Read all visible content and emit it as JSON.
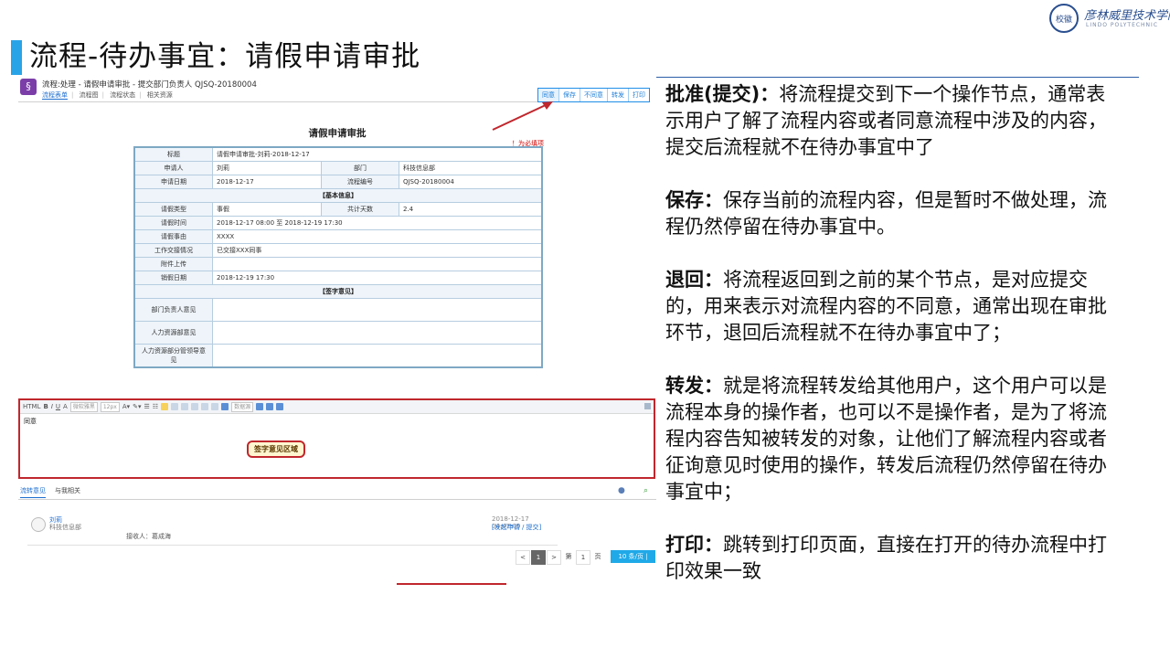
{
  "slide": {
    "title": "流程-待办事宜：请假申请审批",
    "logo_name": "彦林威里技术学院",
    "logo_en": "LINDO POLYTECHNIC",
    "logo_seal": "校徽"
  },
  "app": {
    "title": "流程:处理 - 请假申请审批 - 提交部门负责人 QJSQ-20180004",
    "nav": [
      "流程表单",
      "流程图",
      "流程状态",
      "相关资源"
    ],
    "actions": [
      "同意",
      "保存",
      "不同意",
      "转发",
      "打印"
    ],
    "form_title": "请假申请审批",
    "required_note": "！为必填项",
    "form": {
      "title_label": "标题",
      "title_value": "请假申请审批-刘莉-2018-12-17",
      "applicant_label": "申请人",
      "applicant_value": "刘莉",
      "dept_label": "部门",
      "dept_value": "科技信息部",
      "date_label": "申请日期",
      "date_value": "2018-12-17",
      "flowno_label": "流程编号",
      "flowno_value": "QJSQ-20180004",
      "section_basic": "【基本信息】",
      "leave_type_label": "请假类型",
      "leave_type_value": "事假",
      "days_label": "共计天数",
      "days_value": "2.4",
      "leave_time_label": "请假时间",
      "leave_time_value": "2018-12-17 08:00 至 2018-12-19 17:30",
      "reason_label": "请假事由",
      "reason_value": "XXXX",
      "handover_label": "工作交接情况",
      "handover_value": "已交接XXX同事",
      "attach_label": "附件上传",
      "end_label": "销假日期",
      "end_value": "2018-12-19 17:30",
      "section_sign": "【签字意见】",
      "sign1": "部门负责人意见",
      "sign2": "人力资源部意见",
      "sign3": "人力资源部分管领导意见"
    },
    "editor": {
      "font_placeholder": "微软雅黑",
      "size_placeholder": "12px",
      "value": "同意",
      "sign_area_label": "签字意见区域",
      "toolbar_hint": "数据源"
    },
    "comments": {
      "tab1": "流转意见",
      "tab2": "与我相关",
      "name": "刘莉",
      "dept": "科技信息部",
      "receiver": "接收人：葛成海",
      "time": "2018-12-17   04:47:09",
      "link": "[发起申请 / 提交]"
    },
    "pager": {
      "prev": "<",
      "page": "1",
      "next": ">",
      "jump_pre": "第",
      "jump_val": "1",
      "jump_post": "页",
      "page_size": "10  条/页 | 共1条"
    }
  },
  "panel": {
    "items": [
      {
        "term": "批准(提交)：",
        "desc": "将流程提交到下一个操作节点，通常表示用户了解了流程内容或者同意流程中涉及的内容，提交后流程就不在待办事宜中了"
      },
      {
        "term": "保存：",
        "desc": "保存当前的流程内容，但是暂时不做处理，流程仍然停留在待办事宜中。"
      },
      {
        "term": "退回：",
        "desc": "将流程返回到之前的某个节点，是对应提交的，用来表示对流程内容的不同意，通常出现在审批环节，退回后流程就不在待办事宜中了；"
      },
      {
        "term": "转发：",
        "desc": "就是将流程转发给其他用户，这个用户可以是流程本身的操作者，也可以不是操作者，是为了将流程内容告知被转发的对象，让他们了解流程内容或者征询意见时使用的操作，转发后流程仍然停留在待办事宜中；"
      },
      {
        "term": "打印：",
        "desc": "跳转到打印页面，直接在打开的待办流程中打印效果一致"
      }
    ]
  },
  "colors": {
    "accent": "#29a3e8",
    "arrow_red": "#c0272d",
    "link_blue": "#1e6fd0"
  }
}
